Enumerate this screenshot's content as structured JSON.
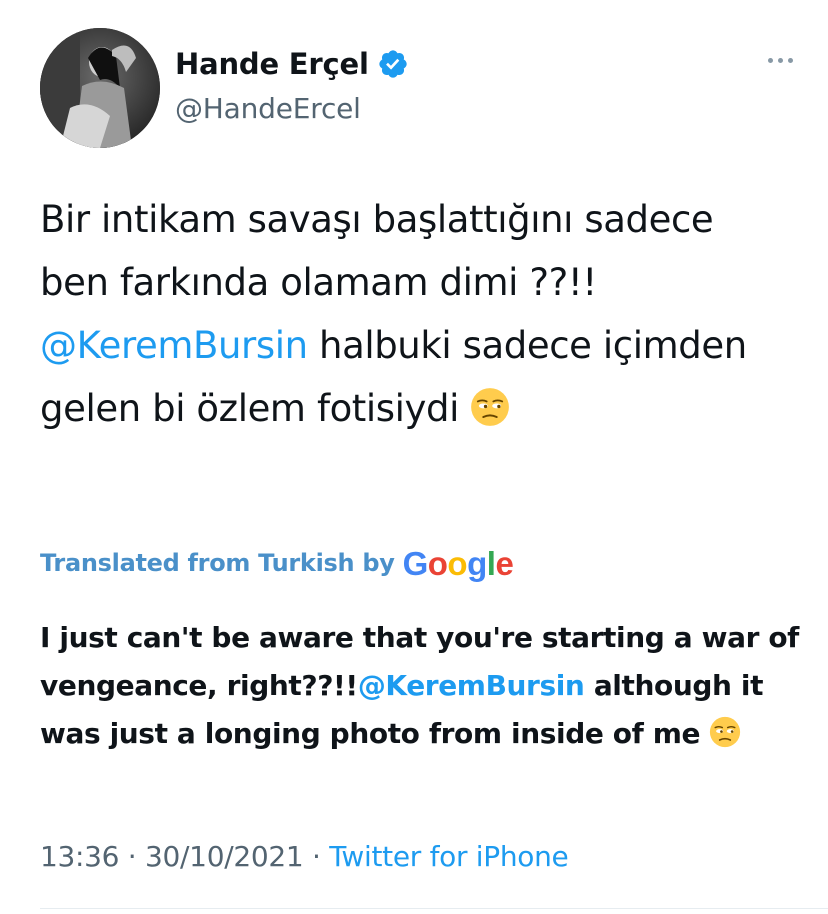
{
  "author": {
    "display_name": "Hande Erçel",
    "handle": "@HandeErcel",
    "verified": true,
    "avatar_icon": "profile-photo"
  },
  "tweet": {
    "text_parts": {
      "before_mention": "Bir intikam savaşı başlattığını sadece ben farkında olamam dimi ??!! ",
      "mention": "@KeremBursin",
      "after_mention": "  halbuki sadece içimden gelen bi özlem fotisiydi "
    },
    "emoji_icon": "unamused-face-emoji"
  },
  "translation": {
    "label": "Translated from Turkish by",
    "provider_letters": [
      "G",
      "o",
      "o",
      "g",
      "l",
      "e"
    ],
    "text_parts": {
      "before_mention": "I just can't be aware that you're starting a war of vengeance, right??!!",
      "mention": "@KeremBursin",
      "after_mention": " although it was just a longing photo from inside of me "
    }
  },
  "meta": {
    "time": "13:36",
    "separator": " · ",
    "date": "30/10/2021",
    "source": "Twitter for iPhone"
  },
  "colors": {
    "text": "#0f1419",
    "secondary": "#536471",
    "link": "#1d9bf0",
    "translated_label": "#4a90c9",
    "verified_badge": "#1d9bf0"
  }
}
